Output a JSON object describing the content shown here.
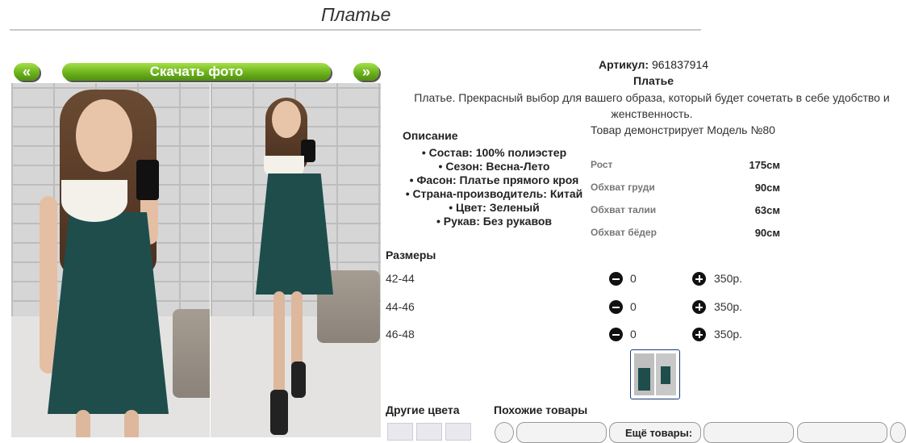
{
  "page": {
    "title": "Платье"
  },
  "gallery": {
    "prev_label": "«",
    "next_label": "»",
    "download_label": "Скачать фото"
  },
  "product": {
    "article_label": "Артикул:",
    "article_value": "961837914",
    "name": "Платье",
    "description": "Платье. Прекрасный выбор для вашего образа, который будет сочетать в себе удобство и женственность.",
    "model_text": "Товар демонстрирует Модель №80"
  },
  "description": {
    "heading": "Описание",
    "items": [
      "Состав: 100% полиэстер",
      "Сезон: Весна-Лето",
      "Фасон: Платье прямого кроя",
      "Страна-производитель: Китай",
      "Цвет: Зеленый",
      "Рукав: Без рукавов"
    ]
  },
  "measurements": [
    {
      "label": "Рост",
      "value": "175см"
    },
    {
      "label": "Обхват груди",
      "value": "90см"
    },
    {
      "label": "Обхват талии",
      "value": "63см"
    },
    {
      "label": "Обхват бёдер",
      "value": "90см"
    }
  ],
  "sizes": {
    "heading": "Размеры",
    "rows": [
      {
        "size": "42-44",
        "qty": "0",
        "price": "350р."
      },
      {
        "size": "44-46",
        "qty": "0",
        "price": "350р."
      },
      {
        "size": "46-48",
        "qty": "0",
        "price": "350р."
      }
    ]
  },
  "bottom": {
    "other_colors": "Другие цвета",
    "similar": "Похожие товары",
    "more": "Ещё товары:"
  },
  "icons": {
    "minus": "minus-circle-icon",
    "plus": "plus-circle-icon"
  },
  "colors": {
    "accent_green": "#6cb31c",
    "dress": "#1e4d4c"
  }
}
